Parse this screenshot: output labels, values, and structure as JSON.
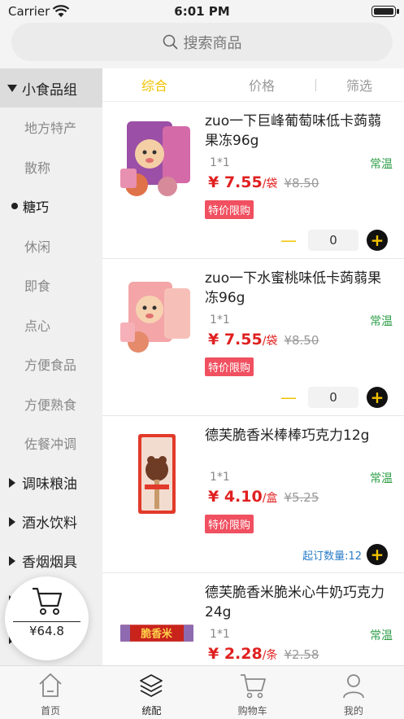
{
  "status_bar": {
    "carrier": "Carrier",
    "time": "6:01 PM"
  },
  "search": {
    "placeholder": "搜索商品"
  },
  "sidebar": {
    "groups": [
      {
        "label": "小食品组",
        "expanded": true,
        "items": [
          "地方特产",
          "散称",
          "糖巧",
          "休闲",
          "即食",
          "点心",
          "方便食品",
          "方便熟食",
          "佐餐冲调"
        ],
        "active_item": "糖巧"
      },
      {
        "label": "调味粮油",
        "expanded": false
      },
      {
        "label": "酒水饮料",
        "expanded": false
      },
      {
        "label": "香烟烟具",
        "expanded": false
      }
    ]
  },
  "sort_bar": {
    "comprehensive": "综合",
    "price": "价格",
    "filter": "筛选"
  },
  "products": [
    {
      "name": "zuo一下巨峰葡萄味低卡蒟蒻果冻96g",
      "spec": "1*1",
      "storage": "常温",
      "price": "¥ 7.55",
      "unit": "/袋",
      "original_price": "¥8.50",
      "tag": "特价限购",
      "qty": "0"
    },
    {
      "name": "zuo一下水蜜桃味低卡蒟蒻果冻96g",
      "spec": "1*1",
      "storage": "常温",
      "price": "¥ 7.55",
      "unit": "/袋",
      "original_price": "¥8.50",
      "tag": "特价限购",
      "qty": "0"
    },
    {
      "name": "德芙脆香米棒棒巧克力12g",
      "spec": "1*1",
      "storage": "常温",
      "price": "¥ 4.10",
      "unit": "/盒",
      "original_price": "¥5.25",
      "tag": "特价限购",
      "min_order": "起订数量:12"
    },
    {
      "name": "德芙脆香米脆米心牛奶巧克力24g",
      "spec": "1*1",
      "storage": "常温",
      "price": "¥ 2.28",
      "unit": "/条",
      "original_price": "¥2.58",
      "package_text": "脆香米"
    }
  ],
  "cart_float": {
    "amount": "¥64.8"
  },
  "tabbar": {
    "home": "首页",
    "catalog": "统配",
    "cart": "购物车",
    "mine": "我的",
    "active": "统配"
  },
  "colors": {
    "accent": "#f2c200",
    "price": "#e02020",
    "tag_bg": "#f05060",
    "storage": "#2e9e48",
    "min_order": "#2a7cc7"
  }
}
